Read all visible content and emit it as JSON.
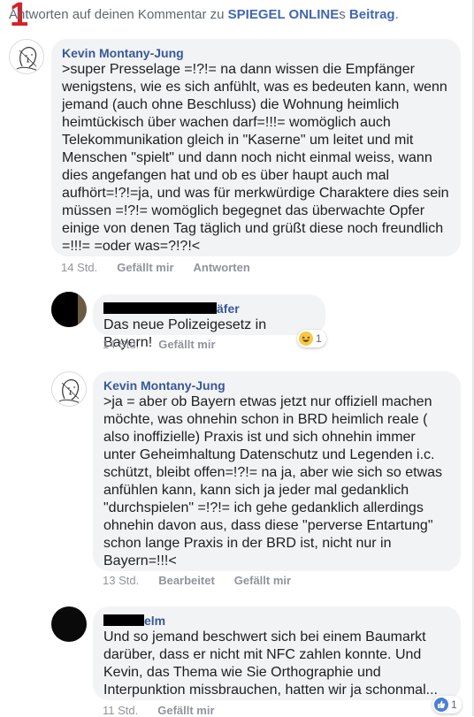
{
  "marker": "1",
  "header": {
    "prefix": "Antworten auf deinen Kommentar zu ",
    "page_link": "SPIEGEL ONLINE",
    "mid": "s ",
    "post_link": "Beitrag",
    "suffix": "."
  },
  "comments": [
    {
      "author": "Kevin Montany-Jung",
      "text": ">super Presselage =!?!= na dann wissen die Empfänger\nwenigstens,  wie es sich anfühlt, was es bedeuten kann, wenn\njemand (auch ohne Beschluss) die Wohnung heimlich\nheimtückisch über wachen  darf=!!!= womöglich auch\nTelekommunikation gleich in \"Kaserne\" um leitet und mit\nMenschen \"spielt\" und dann noch nicht einmal weiss, wann\ndies angefangen hat und ob es über haupt auch mal\naufhört=!?!=ja,  und was für merkwürdige Charaktere dies sein\nmüssen =!?!= womöglich begegnet das überwachte Opfer\neinige von denen Tag täglich und grüßt diese noch freundlich\n=!!!= =oder was=?!?!<",
      "time": "14 Std.",
      "like": "Gefällt mir",
      "reply": "Antworten"
    },
    {
      "author_suffix": "äfer",
      "text": "Das neue Polizeigesetz in Bayern!",
      "time": "14 Std.",
      "like": "Gefällt mir",
      "reaction_icon": "haha-emoji-icon",
      "reaction_count": "1"
    },
    {
      "author": "Kevin Montany-Jung",
      "text": ">ja = aber ob Bayern etwas jetzt nur offiziell machen\nmöchte, was ohnehin schon in BRD heimlich reale (\nalso inoffizielle) Praxis ist und sich ohnehin immer\nunter Geheimhaltung Datenschutz und Legenden  i.c.\nschützt, bleibt offen=!?!= na  ja, aber wie sich so etwas\nanfühlen kann, kann sich ja jeder mal gedanklich\n\"durchspielen\" =!?!= ich gehe gedanklich allerdings\nohnehin davon aus, dass diese \"perverse Entartung\"\nschon lange Praxis in der BRD ist, nicht nur in\nBayern=!!!<",
      "time": "13 Std.",
      "edit": "Bearbeitet",
      "like": "Gefällt mir"
    },
    {
      "author_suffix": "elm",
      "text": "Und so jemand beschwert sich bei einem Baumarkt\ndarüber, dass er nicht mit NFC zahlen konnte. Und\nKevin, das Thema wie Sie Orthographie und\nInterpunktion missbrauchen, hatten wir ja schonmal...",
      "time": "11 Std.",
      "like": "Gefällt mir",
      "reaction_icon": "like-thumb-icon",
      "reaction_count": "1"
    }
  ],
  "colors": {
    "link": "#4267b2",
    "author": "#385898",
    "bubble": "#f2f3f5",
    "meta": "#90949c",
    "marker": "#d0232a"
  }
}
